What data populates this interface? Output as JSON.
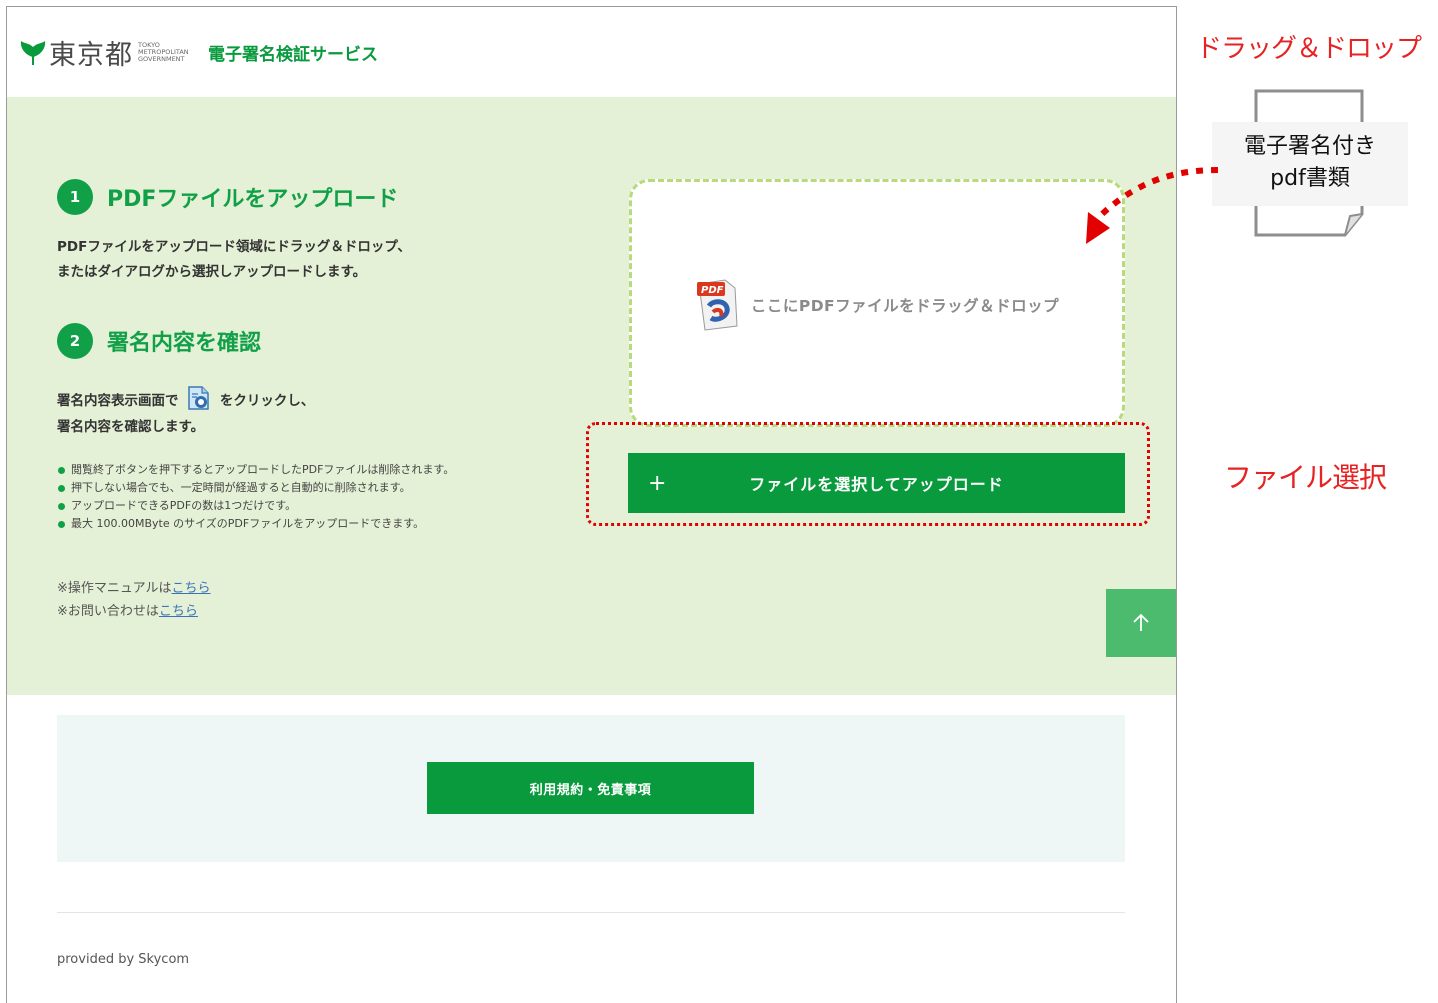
{
  "header": {
    "logo_kanji": "東京都",
    "logo_en": [
      "TOKYO",
      "METROPOLITAN",
      "GOVERNMENT"
    ],
    "service_name": "電子署名検証サービス"
  },
  "steps": [
    {
      "number": "1",
      "title": "PDFファイルをアップロード",
      "lines": [
        "PDFファイルをアップロード領域にドラッグ＆ドロップ、",
        "またはダイアログから選択しアップロードします。"
      ]
    },
    {
      "number": "2",
      "title": "署名内容を確認",
      "line1_before": "署名内容表示画面で",
      "line1_after": "をクリックし、",
      "line2": "署名内容を確認します。"
    }
  ],
  "notes": [
    "閲覧終了ボタンを押下するとアップロードしたPDFファイルは削除されます。",
    "押下しない場合でも、一定時間が経過すると自動的に削除されます。",
    "アップロードできるPDFの数は1つだけです。",
    "最大 100.00MByte のサイズのPDFファイルをアップロードできます。"
  ],
  "links": {
    "manual_prefix": "※操作マニュアルは",
    "manual_link": "こちら",
    "contact_prefix": "※お問い合わせは",
    "contact_link": "こちら"
  },
  "dropzone": {
    "icon": "pdf-file-icon",
    "text": "ここにPDFファイルをドラッグ＆ドロップ"
  },
  "upload_button": {
    "plus": "+",
    "label": "ファイルを選択してアップロード"
  },
  "back_to_top_icon": "arrow-up-icon",
  "terms_button": "利用規約・免責事項",
  "provided_by": "provided by Skycom",
  "annotations": {
    "drag_drop": "ドラッグ＆ドロップ",
    "file_select": "ファイル選択",
    "doc_line1": "電子署名付き",
    "doc_line2": "pdf書類"
  },
  "colors": {
    "brand_green": "#0a9a3e",
    "section_bg": "#e5f1d6",
    "dropzone_border": "#b6da7c",
    "annotation_red": "#e62222"
  }
}
